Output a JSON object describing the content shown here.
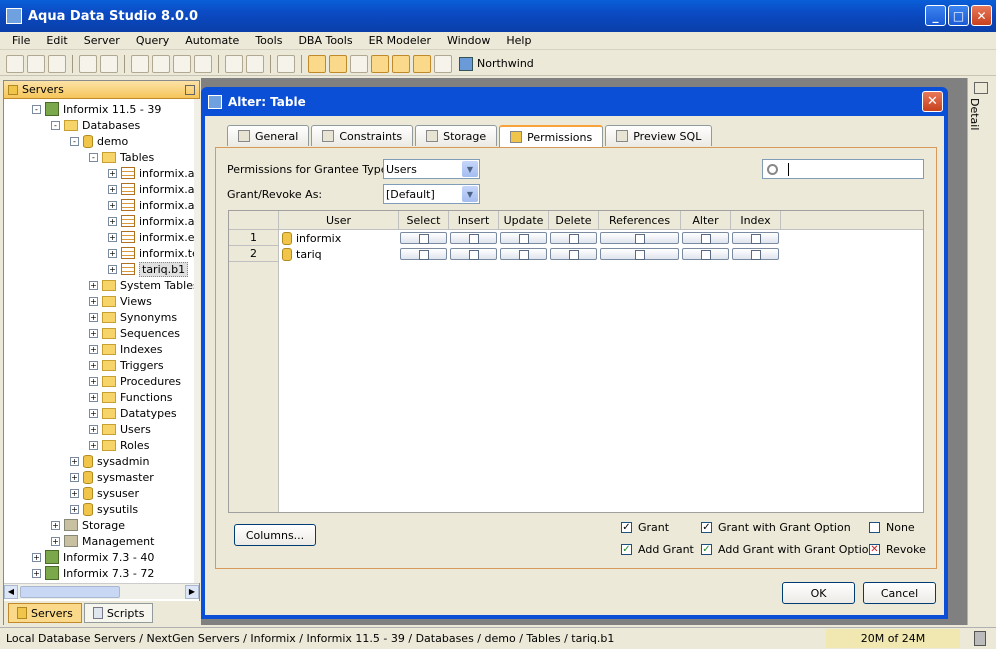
{
  "app": {
    "title": "Aqua Data Studio 8.0.0"
  },
  "menu": [
    "File",
    "Edit",
    "Server",
    "Query",
    "Automate",
    "Tools",
    "DBA Tools",
    "ER Modeler",
    "Window",
    "Help"
  ],
  "toolbar": {
    "connection": "Northwind"
  },
  "servers_panel": {
    "title": "Servers",
    "tabs": [
      "Servers",
      "Scripts"
    ],
    "tree": [
      {
        "label": "Informix 11.5 - 39",
        "level": 1,
        "icon": "server",
        "expand": "-"
      },
      {
        "label": "Databases",
        "level": 2,
        "icon": "folder",
        "expand": "-"
      },
      {
        "label": "demo",
        "level": 3,
        "icon": "db",
        "expand": "-"
      },
      {
        "label": "Tables",
        "level": 4,
        "icon": "folder",
        "expand": "-"
      },
      {
        "label": "informix.a",
        "level": 5,
        "icon": "table",
        "expand": "+"
      },
      {
        "label": "informix.a",
        "level": 5,
        "icon": "table",
        "expand": "+"
      },
      {
        "label": "informix.a",
        "level": 5,
        "icon": "table",
        "expand": "+"
      },
      {
        "label": "informix.a",
        "level": 5,
        "icon": "table",
        "expand": "+"
      },
      {
        "label": "informix.e",
        "level": 5,
        "icon": "table",
        "expand": "+"
      },
      {
        "label": "informix.te",
        "level": 5,
        "icon": "table",
        "expand": "+"
      },
      {
        "label": "tariq.b1",
        "level": 5,
        "icon": "table",
        "expand": "+",
        "selected": true
      },
      {
        "label": "System Tables",
        "level": 4,
        "icon": "folder",
        "expand": "+"
      },
      {
        "label": "Views",
        "level": 4,
        "icon": "folder",
        "expand": "+"
      },
      {
        "label": "Synonyms",
        "level": 4,
        "icon": "folder",
        "expand": "+"
      },
      {
        "label": "Sequences",
        "level": 4,
        "icon": "folder",
        "expand": "+"
      },
      {
        "label": "Indexes",
        "level": 4,
        "icon": "folder",
        "expand": "+"
      },
      {
        "label": "Triggers",
        "level": 4,
        "icon": "folder",
        "expand": "+"
      },
      {
        "label": "Procedures",
        "level": 4,
        "icon": "folder",
        "expand": "+"
      },
      {
        "label": "Functions",
        "level": 4,
        "icon": "folder",
        "expand": "+"
      },
      {
        "label": "Datatypes",
        "level": 4,
        "icon": "folder",
        "expand": "+"
      },
      {
        "label": "Users",
        "level": 4,
        "icon": "folder",
        "expand": "+"
      },
      {
        "label": "Roles",
        "level": 4,
        "icon": "folder",
        "expand": "+"
      },
      {
        "label": "sysadmin",
        "level": 3,
        "icon": "db",
        "expand": "+"
      },
      {
        "label": "sysmaster",
        "level": 3,
        "icon": "db",
        "expand": "+"
      },
      {
        "label": "sysuser",
        "level": 3,
        "icon": "db",
        "expand": "+"
      },
      {
        "label": "sysutils",
        "level": 3,
        "icon": "db",
        "expand": "+"
      },
      {
        "label": "Storage",
        "level": 2,
        "icon": "misc",
        "expand": "+"
      },
      {
        "label": "Management",
        "level": 2,
        "icon": "misc",
        "expand": "+"
      },
      {
        "label": "Informix 7.3 - 40",
        "level": 1,
        "icon": "server",
        "expand": "+"
      },
      {
        "label": "Informix 7.3 - 72",
        "level": 1,
        "icon": "server",
        "expand": "+"
      }
    ]
  },
  "detail_panel": {
    "label": "Detail"
  },
  "dialog": {
    "title": "Alter: Table",
    "tabs": [
      {
        "label": "General",
        "active": false
      },
      {
        "label": "Constraints",
        "active": false
      },
      {
        "label": "Storage",
        "active": false
      },
      {
        "label": "Permissions",
        "active": true
      },
      {
        "label": "Preview SQL",
        "active": false
      }
    ],
    "grantee_type_label": "Permissions for Grantee Type:",
    "grantee_type_value": "Users",
    "grant_revoke_label": "Grant/Revoke As:",
    "grant_revoke_value": "[Default]",
    "search_value": "",
    "columns": [
      "User",
      "Select",
      "Insert",
      "Update",
      "Delete",
      "References",
      "Alter",
      "Index"
    ],
    "rows": [
      {
        "num": "1",
        "user": "informix"
      },
      {
        "num": "2",
        "user": "tariq"
      }
    ],
    "columns_button": "Columns...",
    "legend": [
      {
        "label": "Grant",
        "mark": "✓",
        "kind": "k"
      },
      {
        "label": "Grant with Grant Option",
        "mark": "✓",
        "kind": "k"
      },
      {
        "label": "None",
        "mark": "",
        "kind": "k"
      },
      {
        "label": "Add Grant",
        "mark": "✓",
        "kind": "g"
      },
      {
        "label": "Add Grant with Grant Option",
        "mark": "✓",
        "kind": "g"
      },
      {
        "label": "Revoke",
        "mark": "✕",
        "kind": "r"
      }
    ],
    "ok_button": "OK",
    "cancel_button": "Cancel"
  },
  "status": {
    "path": "Local Database Servers / NextGen Servers / Informix / Informix 11.5 - 39 / Databases / demo / Tables / tariq.b1",
    "memory": "20M of 24M"
  }
}
